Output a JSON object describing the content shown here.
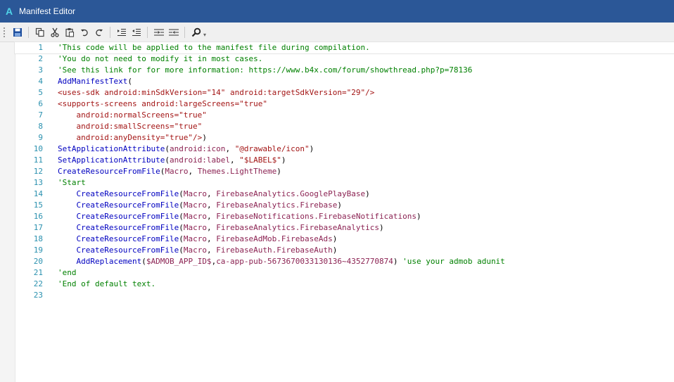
{
  "window": {
    "title": "Manifest Editor",
    "logo_letter": "A"
  },
  "toolbar": {
    "buttons": [
      "save-icon",
      "copy-icon",
      "cut-icon",
      "paste-icon",
      "undo-icon",
      "redo-icon",
      "indent-icon",
      "outdent-icon",
      "comment-icon",
      "uncomment-icon",
      "find-icon"
    ],
    "dropdown_glyph": "▾"
  },
  "editor": {
    "current_line": 1,
    "lines": [
      {
        "n": "1",
        "tokens": [
          {
            "c": "comment",
            "t": "'This code will be applied to the manifest file during compilation."
          }
        ]
      },
      {
        "n": "2",
        "tokens": [
          {
            "c": "comment",
            "t": "'You do not need to modify it in most cases."
          }
        ]
      },
      {
        "n": "3",
        "tokens": [
          {
            "c": "comment",
            "t": "'See this link for for more information: https://www.b4x.com/forum/showthread.php?p=78136"
          }
        ]
      },
      {
        "n": "4",
        "tokens": [
          {
            "c": "ident",
            "t": "AddManifestText"
          },
          {
            "c": "plain",
            "t": "("
          }
        ]
      },
      {
        "n": "5",
        "tokens": [
          {
            "c": "xml",
            "t": "<uses-sdk android:minSdkVersion=\"14\" android:targetSdkVersion=\"29\"/>"
          }
        ]
      },
      {
        "n": "6",
        "tokens": [
          {
            "c": "xml",
            "t": "<supports-screens android:largeScreens=\"true\""
          }
        ]
      },
      {
        "n": "7",
        "tokens": [
          {
            "c": "xml",
            "t": "    android:normalScreens=\"true\""
          }
        ]
      },
      {
        "n": "8",
        "tokens": [
          {
            "c": "xml",
            "t": "    android:smallScreens=\"true\""
          }
        ]
      },
      {
        "n": "9",
        "tokens": [
          {
            "c": "xml",
            "t": "    android:anyDensity=\"true\"/>"
          },
          {
            "c": "plain",
            "t": ")"
          }
        ]
      },
      {
        "n": "10",
        "tokens": [
          {
            "c": "ident",
            "t": "SetApplicationAttribute"
          },
          {
            "c": "plain",
            "t": "("
          },
          {
            "c": "kw",
            "t": "android:icon"
          },
          {
            "c": "plain",
            "t": ", "
          },
          {
            "c": "str",
            "t": "\"@drawable/icon\""
          },
          {
            "c": "plain",
            "t": ")"
          }
        ]
      },
      {
        "n": "11",
        "tokens": [
          {
            "c": "ident",
            "t": "SetApplicationAttribute"
          },
          {
            "c": "plain",
            "t": "("
          },
          {
            "c": "kw",
            "t": "android:label"
          },
          {
            "c": "plain",
            "t": ", "
          },
          {
            "c": "str",
            "t": "\"$LABEL$\""
          },
          {
            "c": "plain",
            "t": ")"
          }
        ]
      },
      {
        "n": "12",
        "tokens": [
          {
            "c": "ident",
            "t": "CreateResourceFromFile"
          },
          {
            "c": "plain",
            "t": "("
          },
          {
            "c": "kw",
            "t": "Macro"
          },
          {
            "c": "plain",
            "t": ", "
          },
          {
            "c": "kw",
            "t": "Themes.LightTheme"
          },
          {
            "c": "plain",
            "t": ")"
          }
        ]
      },
      {
        "n": "13",
        "tokens": [
          {
            "c": "comment",
            "t": "'Start"
          }
        ]
      },
      {
        "n": "14",
        "tokens": [
          {
            "c": "plain",
            "t": "    "
          },
          {
            "c": "ident",
            "t": "CreateResourceFromFile"
          },
          {
            "c": "plain",
            "t": "("
          },
          {
            "c": "kw",
            "t": "Macro"
          },
          {
            "c": "plain",
            "t": ", "
          },
          {
            "c": "kw",
            "t": "FirebaseAnalytics.GooglePlayBase"
          },
          {
            "c": "plain",
            "t": ")"
          }
        ]
      },
      {
        "n": "15",
        "tokens": [
          {
            "c": "plain",
            "t": "    "
          },
          {
            "c": "ident",
            "t": "CreateResourceFromFile"
          },
          {
            "c": "plain",
            "t": "("
          },
          {
            "c": "kw",
            "t": "Macro"
          },
          {
            "c": "plain",
            "t": ", "
          },
          {
            "c": "kw",
            "t": "FirebaseAnalytics.Firebase"
          },
          {
            "c": "plain",
            "t": ")"
          }
        ]
      },
      {
        "n": "16",
        "tokens": [
          {
            "c": "plain",
            "t": "    "
          },
          {
            "c": "ident",
            "t": "CreateResourceFromFile"
          },
          {
            "c": "plain",
            "t": "("
          },
          {
            "c": "kw",
            "t": "Macro"
          },
          {
            "c": "plain",
            "t": ", "
          },
          {
            "c": "kw",
            "t": "FirebaseNotifications.FirebaseNotifications"
          },
          {
            "c": "plain",
            "t": ")"
          }
        ]
      },
      {
        "n": "17",
        "tokens": [
          {
            "c": "plain",
            "t": "    "
          },
          {
            "c": "ident",
            "t": "CreateResourceFromFile"
          },
          {
            "c": "plain",
            "t": "("
          },
          {
            "c": "kw",
            "t": "Macro"
          },
          {
            "c": "plain",
            "t": ", "
          },
          {
            "c": "kw",
            "t": "FirebaseAnalytics.FirebaseAnalytics"
          },
          {
            "c": "plain",
            "t": ")"
          }
        ]
      },
      {
        "n": "18",
        "tokens": [
          {
            "c": "plain",
            "t": "    "
          },
          {
            "c": "ident",
            "t": "CreateResourceFromFile"
          },
          {
            "c": "plain",
            "t": "("
          },
          {
            "c": "kw",
            "t": "Macro"
          },
          {
            "c": "plain",
            "t": ", "
          },
          {
            "c": "kw",
            "t": "FirebaseAdMob.FirebaseAds"
          },
          {
            "c": "plain",
            "t": ")"
          }
        ]
      },
      {
        "n": "19",
        "tokens": [
          {
            "c": "plain",
            "t": "    "
          },
          {
            "c": "ident",
            "t": "CreateResourceFromFile"
          },
          {
            "c": "plain",
            "t": "("
          },
          {
            "c": "kw",
            "t": "Macro"
          },
          {
            "c": "plain",
            "t": ", "
          },
          {
            "c": "kw",
            "t": "FirebaseAuth.FirebaseAuth"
          },
          {
            "c": "plain",
            "t": ")"
          }
        ]
      },
      {
        "n": "20",
        "tokens": [
          {
            "c": "plain",
            "t": "    "
          },
          {
            "c": "ident",
            "t": "AddReplacement"
          },
          {
            "c": "plain",
            "t": "("
          },
          {
            "c": "kw",
            "t": "$ADMOB_APP_ID$"
          },
          {
            "c": "plain",
            "t": ","
          },
          {
            "c": "kw",
            "t": "ca-app-pub-5673670033130136~4352770874"
          },
          {
            "c": "plain",
            "t": ") "
          },
          {
            "c": "comment",
            "t": "'use your admob adunit"
          }
        ]
      },
      {
        "n": "21",
        "tokens": [
          {
            "c": "comment",
            "t": "'end"
          }
        ]
      },
      {
        "n": "22",
        "tokens": [
          {
            "c": "comment",
            "t": "'End of default text."
          }
        ]
      },
      {
        "n": "23",
        "tokens": []
      }
    ]
  }
}
